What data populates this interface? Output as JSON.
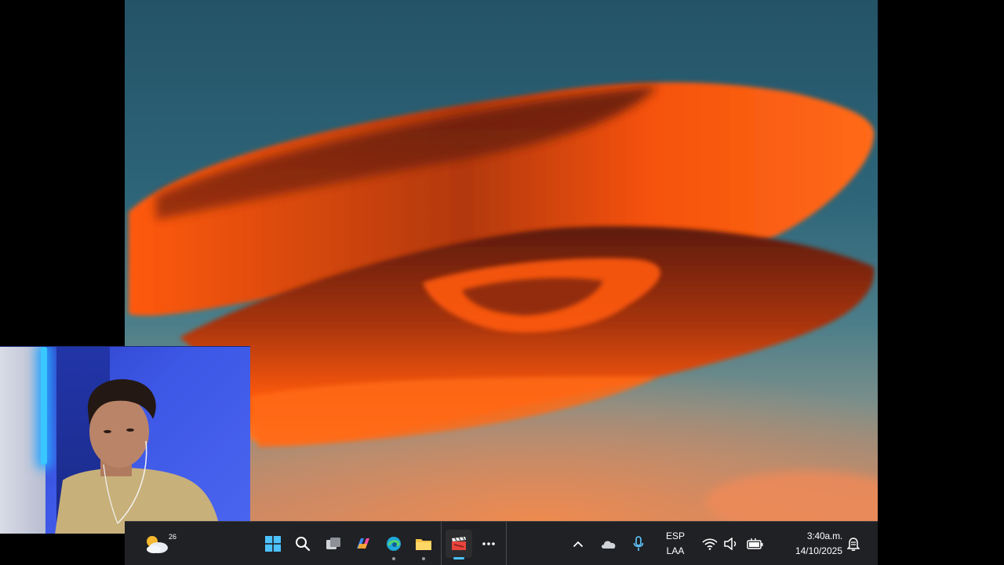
{
  "wallpaper": {
    "name": "lenticular cloud at sunset"
  },
  "taskbar": {
    "weather": {
      "temp": "26",
      "icon": "weather-partly-cloudy-icon"
    },
    "pinned": [
      {
        "id": "start",
        "icon": "windows-start-icon"
      },
      {
        "id": "search",
        "icon": "search-icon"
      },
      {
        "id": "task-view",
        "icon": "task-view-icon"
      },
      {
        "id": "copilot",
        "icon": "copilot-icon"
      },
      {
        "id": "edge",
        "icon": "edge-browser-icon"
      },
      {
        "id": "file-explorer",
        "icon": "folder-icon"
      },
      {
        "id": "media-app",
        "icon": "clapperboard-icon"
      },
      {
        "id": "overflow",
        "icon": "more-icon"
      }
    ],
    "tray": {
      "chevron": "chevron-up-icon",
      "onedrive": "cloud-icon",
      "mic": "microphone-icon",
      "language_top": "ESP",
      "language_bottom": "LAA",
      "wifi": "wifi-icon",
      "volume": "speaker-icon",
      "battery": "battery-icon"
    },
    "clock": {
      "time": "3:40a.m.",
      "date": "14/10/2025"
    },
    "notifications": "notification-bell-icon"
  },
  "colors": {
    "taskbar_bg": "#202124",
    "accent": "#4cc2ff",
    "cloud_orange": "#ff5a0a",
    "sky": "#2c6174"
  }
}
